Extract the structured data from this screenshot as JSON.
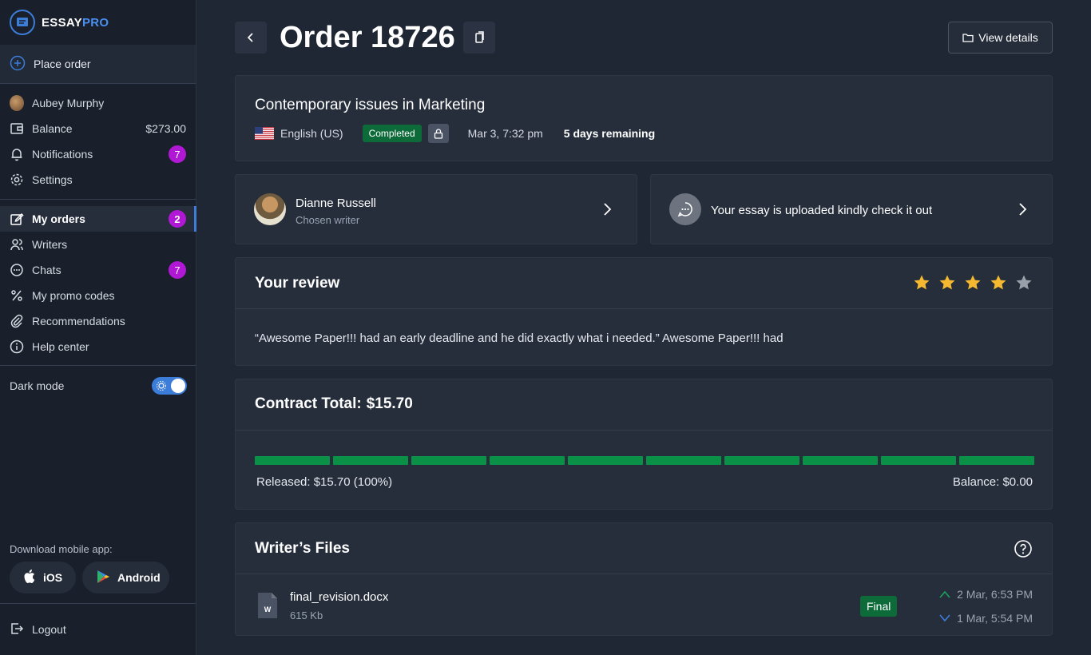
{
  "brand": {
    "name_part1": "ESSAY",
    "name_part2": "PRO"
  },
  "sidebar": {
    "place_order": "Place order",
    "user_name": "Aubey Murphy",
    "balance_label": "Balance",
    "balance_value": "$273.00",
    "notifications_label": "Notifications",
    "notifications_count": "7",
    "settings_label": "Settings",
    "my_orders_label": "My orders",
    "my_orders_count": "2",
    "writers_label": "Writers",
    "chats_label": "Chats",
    "chats_count": "7",
    "promo_label": "My promo codes",
    "recommendations_label": "Recommendations",
    "help_label": "Help center",
    "dark_mode_label": "Dark mode",
    "dark_mode_on": true,
    "download_label": "Download mobile app:",
    "ios_label": "iOS",
    "android_label": "Android",
    "logout_label": "Logout"
  },
  "header": {
    "title": "Order 18726",
    "view_details": "View details"
  },
  "order": {
    "topic": "Contemporary issues in Marketing",
    "language": "English (US)",
    "status": "Completed",
    "date": "Mar 3, 7:32 pm",
    "remaining": "5 days remaining"
  },
  "writer": {
    "name": "Dianne Russell",
    "role": "Chosen writer"
  },
  "message": {
    "text": "Your essay is uploaded kindly check it out"
  },
  "review": {
    "title": "Your review",
    "rating": 4,
    "max_rating": 5,
    "text": "“Awesome Paper!!! had an early deadline and he did exactly what i needed.” Awesome Paper!!! had"
  },
  "contract": {
    "title": "Contract Total:",
    "amount": "$15.70",
    "segments": 10,
    "released_fraction": 1.0,
    "released": "Released: $15.70 (100%)",
    "balance": "Balance: $0.00"
  },
  "files": {
    "title": "Writer’s Files",
    "items": [
      {
        "name": "final_revision.docx",
        "size": "615 Kb",
        "type_letter": "W",
        "badge": "Final",
        "uploaded": "2 Mar, 6:53 PM",
        "downloaded": "1 Mar, 5:54 PM"
      }
    ]
  },
  "colors": {
    "accent": "#3b7dd8",
    "badge": "#b118d6",
    "success": "#0d6b3a",
    "progress": "#0a9147",
    "star": "#f5b82e"
  }
}
